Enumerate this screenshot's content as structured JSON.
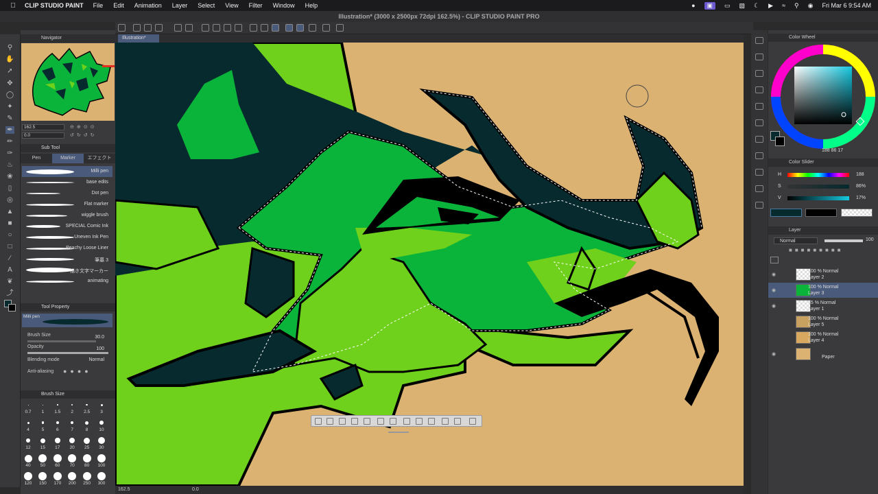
{
  "menubar": {
    "app_name": "CLIP STUDIO PAINT",
    "items": [
      "File",
      "Edit",
      "Animation",
      "Layer",
      "Select",
      "View",
      "Filter",
      "Window",
      "Help"
    ],
    "datetime": "Fri Mar 6  9:54 AM"
  },
  "window": {
    "title": "Illustration* (3000 x 2500px 72dpi 162.5%) - CLIP STUDIO PAINT PRO",
    "canvas_tab": "Illustration*"
  },
  "navigator": {
    "title": "Navigator",
    "zoom": "162.5",
    "rotation": "0.0"
  },
  "subtool": {
    "title": "Sub Tool",
    "tabs": [
      "Pen",
      "Marker",
      "エフェクト"
    ],
    "brushes": [
      "Milli pen",
      "base edits",
      "Dot pen",
      "Flat marker",
      "wiggle brush",
      "SPECIAL Comic Ink",
      "Uneven Ink Pen",
      "Peachy Loose Liner",
      "筆墓 3",
      "描き文字マーカー",
      "animating"
    ]
  },
  "tool_property": {
    "title": "Tool Property",
    "tool_name": "Milli pen",
    "brush_size_label": "Brush Size",
    "brush_size_value": "30.0",
    "opacity_label": "Opacity",
    "opacity_value": "100",
    "blending_label": "Blending mode",
    "blending_value": "Normal",
    "antialias_label": "Anti-aliasing"
  },
  "brush_size_palette": {
    "title": "Brush Size",
    "sizes": [
      "0.7",
      "1",
      "1.5",
      "2",
      "2.5",
      "3",
      "4",
      "5",
      "6",
      "7",
      "8",
      "10",
      "12",
      "15",
      "17",
      "20",
      "25",
      "30",
      "40",
      "50",
      "60",
      "70",
      "80",
      "100",
      "120",
      "150",
      "170",
      "200",
      "250",
      "300"
    ]
  },
  "color_wheel": {
    "title": "Color Wheel",
    "readout": "188  86  17"
  },
  "color_slider": {
    "title": "Color Slider",
    "h_label": "H",
    "h_value": "188",
    "s_label": "S",
    "s_value": "86%",
    "v_label": "V",
    "v_value": "17%",
    "main_color": "#062a2e"
  },
  "layer_panel": {
    "title": "Layer",
    "blend_mode": "Normal",
    "opacity": "100",
    "layers": [
      {
        "line1": "100 % Normal",
        "line2": "Layer 2"
      },
      {
        "line1": "100 % Normal",
        "line2": "Layer 3"
      },
      {
        "line1": "45 % Normal",
        "line2": "Layer 1"
      },
      {
        "line1": "100 % Normal",
        "line2": "Layer 5"
      },
      {
        "line1": "100 % Normal",
        "line2": "Layer 4"
      },
      {
        "line1": "",
        "line2": "Paper"
      }
    ]
  },
  "statusbar": {
    "zoom": "162.5",
    "angle": "0.0"
  },
  "colors": {
    "canvas_bg": "#dcb272",
    "dragon_green": "#0ab33a",
    "dragon_lime": "#6fd11c",
    "dragon_dark": "#062a2e",
    "selection_accent": "#4a5a7a"
  }
}
